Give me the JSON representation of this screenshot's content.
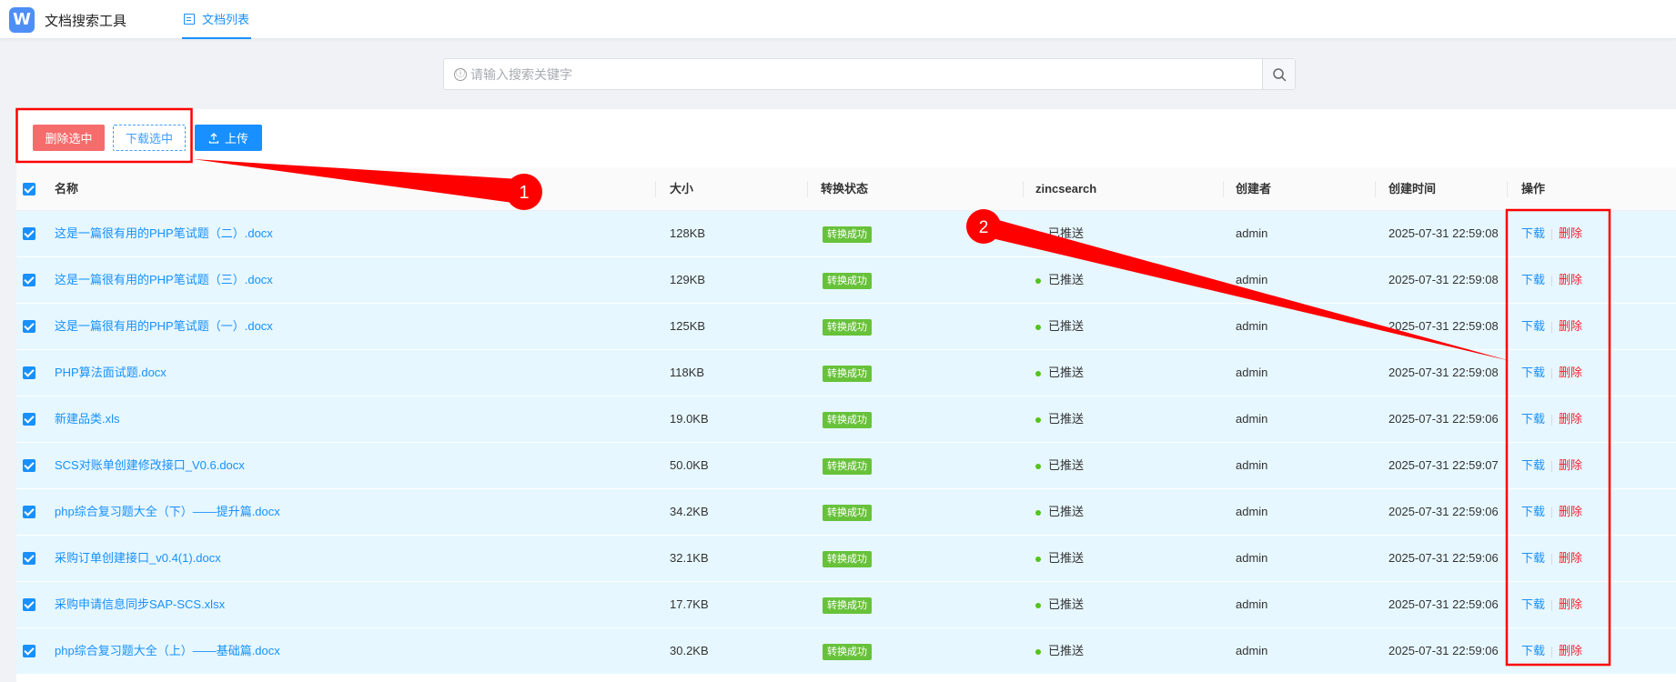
{
  "header": {
    "logo_letter": "W",
    "app_title": "文档搜索工具",
    "nav_tab_label": "文档列表"
  },
  "search": {
    "placeholder": "请输入搜索关键字",
    "info_icon": "ⓘ"
  },
  "toolbar": {
    "delete_selected_label": "删除选中",
    "download_selected_label": "下载选中",
    "upload_label": "上传"
  },
  "table": {
    "columns": {
      "name": "名称",
      "size": "大小",
      "status": "转换状态",
      "zincsearch": "zincsearch",
      "creator": "创建者",
      "created_at": "创建时间",
      "actions": "操作"
    },
    "rows": [
      {
        "name": "这是一篇很有用的PHP笔试题（二）.docx",
        "size": "128KB",
        "status": "转换成功",
        "push": "已推送",
        "creator": "admin",
        "created_at": "2025-07-31 22:59:08"
      },
      {
        "name": "这是一篇很有用的PHP笔试题（三）.docx",
        "size": "129KB",
        "status": "转换成功",
        "push": "已推送",
        "creator": "admin",
        "created_at": "2025-07-31 22:59:08"
      },
      {
        "name": "这是一篇很有用的PHP笔试题（一）.docx",
        "size": "125KB",
        "status": "转换成功",
        "push": "已推送",
        "creator": "admin",
        "created_at": "2025-07-31 22:59:08"
      },
      {
        "name": "PHP算法面试题.docx",
        "size": "118KB",
        "status": "转换成功",
        "push": "已推送",
        "creator": "admin",
        "created_at": "2025-07-31 22:59:08"
      },
      {
        "name": "新建品类.xls",
        "size": "19.0KB",
        "status": "转换成功",
        "push": "已推送",
        "creator": "admin",
        "created_at": "2025-07-31 22:59:06"
      },
      {
        "name": "SCS对账单创建修改接口_V0.6.docx",
        "size": "50.0KB",
        "status": "转换成功",
        "push": "已推送",
        "creator": "admin",
        "created_at": "2025-07-31 22:59:07"
      },
      {
        "name": "php综合复习题大全（下）——提升篇.docx",
        "size": "34.2KB",
        "status": "转换成功",
        "push": "已推送",
        "creator": "admin",
        "created_at": "2025-07-31 22:59:06"
      },
      {
        "name": "采购订单创建接口_v0.4(1).docx",
        "size": "32.1KB",
        "status": "转换成功",
        "push": "已推送",
        "creator": "admin",
        "created_at": "2025-07-31 22:59:06"
      },
      {
        "name": "采购申请信息同步SAP-SCS.xlsx",
        "size": "17.7KB",
        "status": "转换成功",
        "push": "已推送",
        "creator": "admin",
        "created_at": "2025-07-31 22:59:06"
      },
      {
        "name": "php综合复习题大全（上）——基础篇.docx",
        "size": "30.2KB",
        "status": "转换成功",
        "push": "已推送",
        "creator": "admin",
        "created_at": "2025-07-31 22:59:06"
      }
    ],
    "action_download": "下载",
    "action_delete": "删除"
  },
  "annotations": {
    "marker_1": "1",
    "marker_2": "2",
    "color": "#ff0000"
  },
  "colors": {
    "primary": "#1890ff",
    "danger": "#f56c6c",
    "success": "#67c23a",
    "row_selected": "#e6f7ff"
  },
  "icons": {
    "search": "search-icon",
    "upload": "upload-icon",
    "list": "list-icon",
    "check": "checkbox-checked-icon"
  }
}
